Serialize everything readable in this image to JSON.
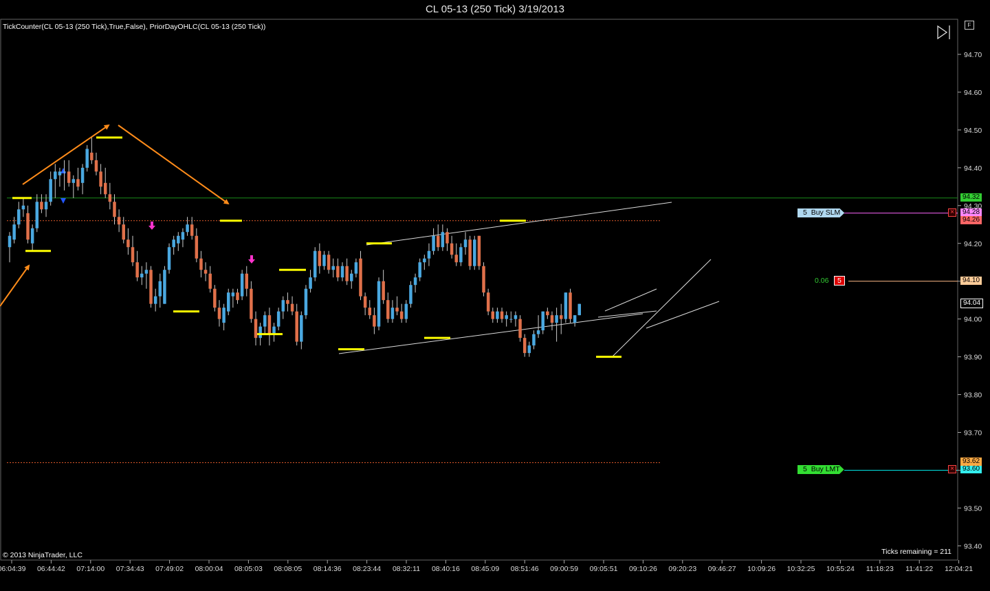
{
  "title": "CL 05-13 (250 Tick)  3/19/2013",
  "indicator_label": "TickCounter(CL 05-13 (250 Tick),True,False), PriorDayOHLC(CL 05-13 (250 Tick))",
  "copyright": "© 2013 NinjaTrader, LLC",
  "ticks_remaining": "Ticks remaining = 211",
  "f_button": "F",
  "last_price_label": "94.04",
  "colors": {
    "up": "#4aa8e0",
    "down": "#e0704a",
    "swing": "#ffff00",
    "arrow": "#ff8c1a",
    "prior_day": "#e05a2a",
    "green_line": "#1a8c1a",
    "buy_slm": "#ff66ff",
    "buy_lmt": "#00e6e6",
    "position": "#ffbb88"
  },
  "orders": {
    "buy_slm": {
      "qty": "5",
      "label": "Buy SLM",
      "price": "94.28"
    },
    "position": {
      "pnl": "0.06",
      "qty": "5",
      "price": "94.10"
    },
    "buy_lmt": {
      "qty": "5",
      "label": "Buy LMT",
      "price": "93.60"
    }
  },
  "price_tags": {
    "green_top": "94.32",
    "prior_upper": "94.26",
    "prior_lower": "93.62"
  },
  "chart_data": {
    "type": "candlestick",
    "y_ticks": [
      "94.70",
      "94.60",
      "94.50",
      "94.40",
      "94.30",
      "94.20",
      "94.10",
      "94.00",
      "93.90",
      "93.80",
      "93.70",
      "93.60",
      "93.50",
      "93.40"
    ],
    "x_ticks": [
      "06:04:39",
      "06:44:42",
      "07:14:00",
      "07:34:43",
      "07:49:02",
      "08:00:04",
      "08:05:03",
      "08:08:05",
      "08:14:36",
      "08:23:44",
      "08:32:11",
      "08:40:16",
      "08:45:09",
      "08:51:46",
      "09:00:59",
      "09:05:51",
      "09:10:26",
      "09:20:23",
      "09:46:27",
      "10:09:26",
      "10:32:25",
      "10:55:24",
      "11:18:23",
      "11:41:22",
      "12:04:21"
    ],
    "ylim": [
      93.37,
      94.75
    ],
    "grid": false,
    "levels": {
      "green_line": 94.32,
      "prior_upper": 94.26,
      "prior_lower": 93.62,
      "buy_slm": 94.28,
      "position": 94.1,
      "buy_lmt": 93.6
    },
    "candles": [
      {
        "o": 94.19,
        "h": 94.23,
        "l": 94.15,
        "c": 94.22
      },
      {
        "o": 94.21,
        "h": 94.27,
        "l": 94.2,
        "c": 94.25
      },
      {
        "o": 94.25,
        "h": 94.31,
        "l": 94.24,
        "c": 94.29
      },
      {
        "o": 94.29,
        "h": 94.32,
        "l": 94.27,
        "c": 94.3
      },
      {
        "o": 94.28,
        "h": 94.3,
        "l": 94.2,
        "c": 94.21
      },
      {
        "o": 94.2,
        "h": 94.25,
        "l": 94.18,
        "c": 94.24
      },
      {
        "o": 94.24,
        "h": 94.33,
        "l": 94.23,
        "c": 94.31
      },
      {
        "o": 94.31,
        "h": 94.33,
        "l": 94.28,
        "c": 94.29
      },
      {
        "o": 94.29,
        "h": 94.33,
        "l": 94.27,
        "c": 94.31
      },
      {
        "o": 94.31,
        "h": 94.39,
        "l": 94.3,
        "c": 94.37
      },
      {
        "o": 94.37,
        "h": 94.41,
        "l": 94.32,
        "c": 94.39
      },
      {
        "o": 94.38,
        "h": 94.4,
        "l": 94.35,
        "c": 94.39
      },
      {
        "o": 94.39,
        "h": 94.42,
        "l": 94.34,
        "c": 94.39
      },
      {
        "o": 94.39,
        "h": 94.42,
        "l": 94.35,
        "c": 94.36
      },
      {
        "o": 94.36,
        "h": 94.38,
        "l": 94.32,
        "c": 94.37
      },
      {
        "o": 94.37,
        "h": 94.4,
        "l": 94.34,
        "c": 94.35
      },
      {
        "o": 94.36,
        "h": 94.41,
        "l": 94.33,
        "c": 94.4
      },
      {
        "o": 94.4,
        "h": 94.46,
        "l": 94.39,
        "c": 94.45
      },
      {
        "o": 94.44,
        "h": 94.48,
        "l": 94.41,
        "c": 94.42
      },
      {
        "o": 94.42,
        "h": 94.44,
        "l": 94.38,
        "c": 94.39
      },
      {
        "o": 94.39,
        "h": 94.41,
        "l": 94.33,
        "c": 94.35
      },
      {
        "o": 94.36,
        "h": 94.4,
        "l": 94.32,
        "c": 94.33
      },
      {
        "o": 94.33,
        "h": 94.36,
        "l": 94.29,
        "c": 94.31
      },
      {
        "o": 94.31,
        "h": 94.33,
        "l": 94.25,
        "c": 94.27
      },
      {
        "o": 94.27,
        "h": 94.29,
        "l": 94.23,
        "c": 94.25
      },
      {
        "o": 94.25,
        "h": 94.27,
        "l": 94.2,
        "c": 94.21
      },
      {
        "o": 94.21,
        "h": 94.24,
        "l": 94.17,
        "c": 94.19
      },
      {
        "o": 94.19,
        "h": 94.22,
        "l": 94.14,
        "c": 94.15
      },
      {
        "o": 94.15,
        "h": 94.18,
        "l": 94.1,
        "c": 94.11
      },
      {
        "o": 94.11,
        "h": 94.14,
        "l": 94.09,
        "c": 94.12
      },
      {
        "o": 94.12,
        "h": 94.15,
        "l": 94.08,
        "c": 94.13
      },
      {
        "o": 94.13,
        "h": 94.14,
        "l": 94.03,
        "c": 94.04
      },
      {
        "o": 94.04,
        "h": 94.08,
        "l": 94.02,
        "c": 94.06
      },
      {
        "o": 94.06,
        "h": 94.12,
        "l": 94.03,
        "c": 94.1
      },
      {
        "o": 94.04,
        "h": 94.14,
        "l": 94.04,
        "c": 94.13
      },
      {
        "o": 94.13,
        "h": 94.2,
        "l": 94.12,
        "c": 94.19
      },
      {
        "o": 94.19,
        "h": 94.22,
        "l": 94.17,
        "c": 94.21
      },
      {
        "o": 94.2,
        "h": 94.23,
        "l": 94.18,
        "c": 94.22
      },
      {
        "o": 94.21,
        "h": 94.24,
        "l": 94.19,
        "c": 94.23
      },
      {
        "o": 94.23,
        "h": 94.27,
        "l": 94.22,
        "c": 94.25
      },
      {
        "o": 94.25,
        "h": 94.27,
        "l": 94.21,
        "c": 94.22
      },
      {
        "o": 94.22,
        "h": 94.24,
        "l": 94.15,
        "c": 94.16
      },
      {
        "o": 94.16,
        "h": 94.18,
        "l": 94.11,
        "c": 94.13
      },
      {
        "o": 94.13,
        "h": 94.15,
        "l": 94.1,
        "c": 94.12
      },
      {
        "o": 94.12,
        "h": 94.14,
        "l": 94.07,
        "c": 94.08
      },
      {
        "o": 94.08,
        "h": 94.09,
        "l": 94.02,
        "c": 94.03
      },
      {
        "o": 94.03,
        "h": 94.05,
        "l": 93.98,
        "c": 94.0
      },
      {
        "o": 93.99,
        "h": 94.04,
        "l": 93.97,
        "c": 94.03
      },
      {
        "o": 94.02,
        "h": 94.08,
        "l": 94.01,
        "c": 94.07
      },
      {
        "o": 94.06,
        "h": 94.08,
        "l": 94.03,
        "c": 94.07
      },
      {
        "o": 94.07,
        "h": 94.08,
        "l": 94.04,
        "c": 94.05
      },
      {
        "o": 94.06,
        "h": 94.13,
        "l": 94.05,
        "c": 94.12
      },
      {
        "o": 94.12,
        "h": 94.14,
        "l": 94.06,
        "c": 94.08
      },
      {
        "o": 94.08,
        "h": 94.1,
        "l": 93.99,
        "c": 94.0
      },
      {
        "o": 94.0,
        "h": 94.02,
        "l": 93.93,
        "c": 93.95
      },
      {
        "o": 93.95,
        "h": 93.99,
        "l": 93.93,
        "c": 93.98
      },
      {
        "o": 93.98,
        "h": 94.02,
        "l": 93.96,
        "c": 94.01
      },
      {
        "o": 94.01,
        "h": 94.03,
        "l": 93.93,
        "c": 93.96
      },
      {
        "o": 93.96,
        "h": 93.99,
        "l": 93.94,
        "c": 93.98
      },
      {
        "o": 93.98,
        "h": 94.03,
        "l": 93.97,
        "c": 94.02
      },
      {
        "o": 94.02,
        "h": 94.06,
        "l": 94.0,
        "c": 94.05
      },
      {
        "o": 94.05,
        "h": 94.07,
        "l": 94.02,
        "c": 94.04
      },
      {
        "o": 94.04,
        "h": 94.06,
        "l": 94.01,
        "c": 94.02
      },
      {
        "o": 94.02,
        "h": 94.04,
        "l": 93.93,
        "c": 93.94
      },
      {
        "o": 93.94,
        "h": 94.02,
        "l": 93.92,
        "c": 94.01
      },
      {
        "o": 94.01,
        "h": 94.09,
        "l": 94.0,
        "c": 94.08
      },
      {
        "o": 94.08,
        "h": 94.13,
        "l": 94.07,
        "c": 94.11
      },
      {
        "o": 94.11,
        "h": 94.19,
        "l": 94.1,
        "c": 94.18
      },
      {
        "o": 94.18,
        "h": 94.2,
        "l": 94.12,
        "c": 94.14
      },
      {
        "o": 94.14,
        "h": 94.18,
        "l": 94.13,
        "c": 94.17
      },
      {
        "o": 94.17,
        "h": 94.18,
        "l": 94.12,
        "c": 94.13
      },
      {
        "o": 94.13,
        "h": 94.16,
        "l": 94.11,
        "c": 94.14
      },
      {
        "o": 94.14,
        "h": 94.16,
        "l": 94.1,
        "c": 94.11
      },
      {
        "o": 94.11,
        "h": 94.15,
        "l": 94.1,
        "c": 94.14
      },
      {
        "o": 94.14,
        "h": 94.16,
        "l": 94.09,
        "c": 94.1
      },
      {
        "o": 94.1,
        "h": 94.13,
        "l": 94.08,
        "c": 94.12
      },
      {
        "o": 94.12,
        "h": 94.16,
        "l": 94.11,
        "c": 94.15
      },
      {
        "o": 94.16,
        "h": 94.18,
        "l": 94.05,
        "c": 94.06
      },
      {
        "o": 94.06,
        "h": 94.07,
        "l": 94.01,
        "c": 94.03
      },
      {
        "o": 94.03,
        "h": 94.05,
        "l": 94.0,
        "c": 94.01
      },
      {
        "o": 94.01,
        "h": 94.03,
        "l": 93.96,
        "c": 93.98
      },
      {
        "o": 93.98,
        "h": 94.11,
        "l": 93.97,
        "c": 94.1
      },
      {
        "o": 94.1,
        "h": 94.13,
        "l": 94.04,
        "c": 94.05
      },
      {
        "o": 94.05,
        "h": 94.07,
        "l": 93.99,
        "c": 94.0
      },
      {
        "o": 94.0,
        "h": 94.05,
        "l": 93.99,
        "c": 94.03
      },
      {
        "o": 94.03,
        "h": 94.06,
        "l": 94.01,
        "c": 94.02
      },
      {
        "o": 94.02,
        "h": 94.04,
        "l": 93.99,
        "c": 94.0
      },
      {
        "o": 94.0,
        "h": 94.05,
        "l": 93.99,
        "c": 94.04
      },
      {
        "o": 94.04,
        "h": 94.1,
        "l": 94.03,
        "c": 94.09
      },
      {
        "o": 94.09,
        "h": 94.12,
        "l": 94.07,
        "c": 94.11
      },
      {
        "o": 94.11,
        "h": 94.16,
        "l": 94.1,
        "c": 94.15
      },
      {
        "o": 94.15,
        "h": 94.17,
        "l": 94.13,
        "c": 94.16
      },
      {
        "o": 94.16,
        "h": 94.2,
        "l": 94.14,
        "c": 94.18
      },
      {
        "o": 94.18,
        "h": 94.24,
        "l": 94.17,
        "c": 94.22
      },
      {
        "o": 94.22,
        "h": 94.25,
        "l": 94.18,
        "c": 94.19
      },
      {
        "o": 94.19,
        "h": 94.25,
        "l": 94.18,
        "c": 94.23
      },
      {
        "o": 94.23,
        "h": 94.24,
        "l": 94.18,
        "c": 94.2
      },
      {
        "o": 94.2,
        "h": 94.22,
        "l": 94.16,
        "c": 94.17
      },
      {
        "o": 94.17,
        "h": 94.2,
        "l": 94.14,
        "c": 94.15
      },
      {
        "o": 94.15,
        "h": 94.2,
        "l": 94.14,
        "c": 94.19
      },
      {
        "o": 94.19,
        "h": 94.23,
        "l": 94.17,
        "c": 94.21
      },
      {
        "o": 94.21,
        "h": 94.22,
        "l": 94.13,
        "c": 94.14
      },
      {
        "o": 94.14,
        "h": 94.22,
        "l": 94.13,
        "c": 94.21
      },
      {
        "o": 94.22,
        "h": 94.22,
        "l": 94.13,
        "c": 94.14
      },
      {
        "o": 94.14,
        "h": 94.15,
        "l": 94.06,
        "c": 94.07
      },
      {
        "o": 94.07,
        "h": 94.08,
        "l": 94.01,
        "c": 94.02
      },
      {
        "o": 94.02,
        "h": 94.03,
        "l": 93.99,
        "c": 94.0
      },
      {
        "o": 94.0,
        "h": 94.03,
        "l": 93.99,
        "c": 94.02
      },
      {
        "o": 94.02,
        "h": 94.03,
        "l": 93.99,
        "c": 94.0
      },
      {
        "o": 94.0,
        "h": 94.02,
        "l": 93.98,
        "c": 94.01
      },
      {
        "o": 94.0,
        "h": 94.02,
        "l": 93.99,
        "c": 94.0
      },
      {
        "o": 94.0,
        "h": 94.02,
        "l": 93.98,
        "c": 94.01
      },
      {
        "o": 94.0,
        "h": 94.01,
        "l": 93.94,
        "c": 93.95
      },
      {
        "o": 93.95,
        "h": 93.96,
        "l": 93.9,
        "c": 93.91
      },
      {
        "o": 93.91,
        "h": 93.94,
        "l": 93.9,
        "c": 93.93
      },
      {
        "o": 93.93,
        "h": 93.97,
        "l": 93.92,
        "c": 93.96
      },
      {
        "o": 93.96,
        "h": 94.01,
        "l": 93.95,
        "c": 93.97
      },
      {
        "o": 93.97,
        "h": 94.02,
        "l": 93.96,
        "c": 94.02
      },
      {
        "o": 94.02,
        "h": 94.03,
        "l": 94.0,
        "c": 94.01
      },
      {
        "o": 94.01,
        "h": 94.02,
        "l": 93.97,
        "c": 93.99
      },
      {
        "o": 93.99,
        "h": 94.03,
        "l": 93.94,
        "c": 94.01
      },
      {
        "o": 94.01,
        "h": 94.04,
        "l": 93.96,
        "c": 94.0
      },
      {
        "o": 94.0,
        "h": 94.07,
        "l": 93.99,
        "c": 94.07
      },
      {
        "o": 94.07,
        "h": 94.08,
        "l": 93.99,
        "c": 94.0
      },
      {
        "o": 93.99,
        "h": 94.01,
        "l": 93.98,
        "c": 94.01
      },
      {
        "o": 94.01,
        "h": 94.04,
        "l": 94.01,
        "c": 94.04
      }
    ]
  }
}
